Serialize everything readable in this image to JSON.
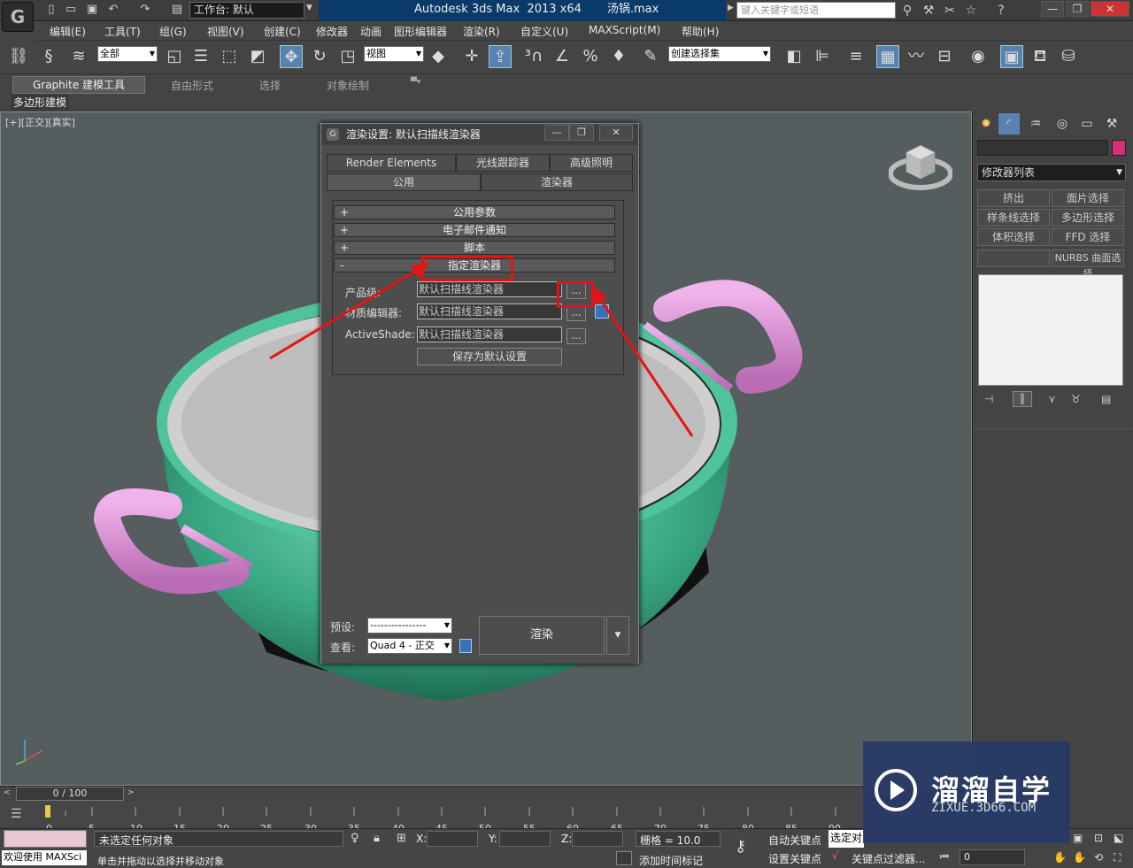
{
  "app": {
    "logo_glyph": "G",
    "workspace": "工作台: 默认",
    "title": "Autodesk 3ds Max  2013 x64       汤锅.max",
    "search_placeholder": "键入关键字或短语",
    "window_controls": [
      "—",
      "❐",
      "✕"
    ]
  },
  "menu": [
    "编辑(E)",
    "工具(T)",
    "组(G)",
    "视图(V)",
    "创建(C)",
    "修改器",
    "动画",
    "图形编辑器",
    "渲染(R)",
    "自定义(U)",
    "MAXScript(M)",
    "帮助(H)"
  ],
  "toolbar": {
    "filter_dropdown": "全部",
    "refcoord_dropdown": "视图",
    "selection_set": "创建选择集"
  },
  "ribbon": {
    "tabs": [
      "Graphite 建模工具",
      "自由形式",
      "选择",
      "对象绘制"
    ],
    "sub_label": "多边形建模"
  },
  "viewport": {
    "label": "[+][正交][真实]",
    "bg_color": "#555d5e"
  },
  "command_panel": {
    "modifier_list": "修改器列表",
    "buttons": [
      "挤出",
      "面片选择",
      "样条线选择",
      "多边形选择",
      "体积选择",
      "FFD 选择",
      "",
      "NURBS 曲面选择"
    ],
    "swatch_color": "#d4307a"
  },
  "dialog": {
    "title": "渲染设置: 默认扫描线渲染器",
    "tabs_row1": [
      "Render Elements",
      "光线跟踪器",
      "高级照明"
    ],
    "tabs_row2": [
      "公用",
      "渲染器"
    ],
    "rollouts": [
      {
        "sign": "+",
        "label": "公用参数"
      },
      {
        "sign": "+",
        "label": "电子邮件通知"
      },
      {
        "sign": "+",
        "label": "脚本"
      },
      {
        "sign": "-",
        "label": "指定渲染器"
      }
    ],
    "fields": [
      {
        "label": "产品级:",
        "value": "默认扫描线渲染器"
      },
      {
        "label": "材质编辑器:",
        "value": "默认扫描线渲染器"
      },
      {
        "label": "ActiveShade:",
        "value": "默认扫描线渲染器"
      }
    ],
    "dots": "...",
    "save_default": "保存为默认设置",
    "preset_label": "预设:",
    "preset_value": "----------------",
    "view_label": "查看:",
    "view_value": "Quad 4 - 正交",
    "render_button": "渲染"
  },
  "timeline": {
    "frame": "0 / 100",
    "ticks": [
      "0",
      "5",
      "10",
      "15",
      "20",
      "25",
      "30",
      "35",
      "40",
      "45",
      "50",
      "55",
      "60",
      "65",
      "70",
      "75",
      "80",
      "85",
      "90"
    ]
  },
  "status": {
    "welcome": "欢迎使用 MAXSci",
    "no_selection": "未选定任何对象",
    "hint": "单击并拖动以选择并移动对象",
    "x_label": "X:",
    "y_label": "Y:",
    "z_label": "Z:",
    "grid": "栅格 = 10.0",
    "auto_key": "自动关键点",
    "selected": "选定对",
    "set_key": "设置关键点",
    "key_filter": "关键点过滤器...",
    "add_time_tag": "添加时间标记",
    "frame_field": "0"
  },
  "watermark": {
    "brand": "溜溜自学",
    "url": "ZIXUE.3D66.COM"
  },
  "annotation_color": "#e41414"
}
